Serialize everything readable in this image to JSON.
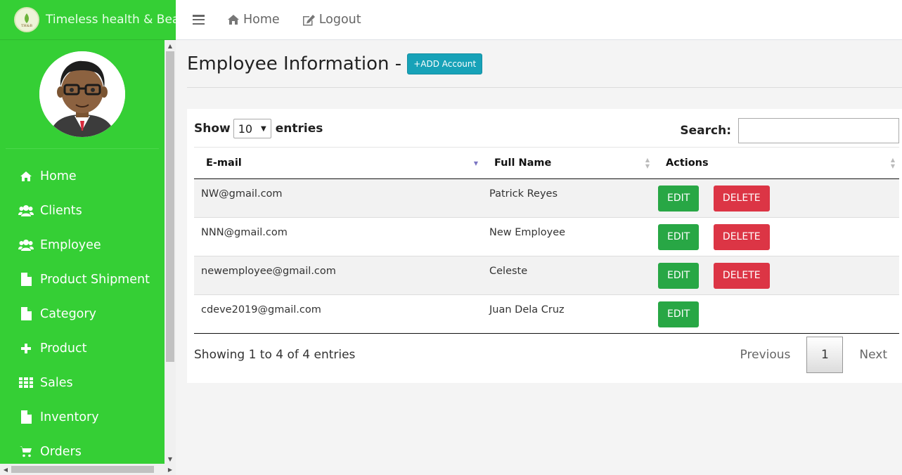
{
  "brand": {
    "title": "Timeless health & Beauty"
  },
  "topbar": {
    "home_label": "Home",
    "logout_label": "Logout"
  },
  "sidebar": {
    "items": [
      {
        "label": "Home",
        "icon": "home-icon"
      },
      {
        "label": "Clients",
        "icon": "users-icon"
      },
      {
        "label": "Employee",
        "icon": "users-icon"
      },
      {
        "label": "Product Shipment",
        "icon": "file-icon"
      },
      {
        "label": "Category",
        "icon": "file-icon"
      },
      {
        "label": "Product",
        "icon": "plus-icon"
      },
      {
        "label": "Sales",
        "icon": "grid-icon"
      },
      {
        "label": "Inventory",
        "icon": "file-icon"
      },
      {
        "label": "Orders",
        "icon": "cart-icon"
      }
    ]
  },
  "page": {
    "title": "Employee Information -",
    "add_button": "+ADD Account"
  },
  "datatable": {
    "show_label": "Show",
    "entries_label": "entries",
    "page_length": "10",
    "search_label": "Search:",
    "search_value": "",
    "columns": [
      "E-mail",
      "Full Name",
      "Actions"
    ],
    "rows": [
      {
        "email": "NW@gmail.com",
        "name": "Patrick Reyes",
        "actions": [
          "EDIT",
          "DELETE"
        ]
      },
      {
        "email": "NNN@gmail.com",
        "name": "New Employee",
        "actions": [
          "EDIT",
          "DELETE"
        ]
      },
      {
        "email": "newemployee@gmail.com",
        "name": "Celeste",
        "actions": [
          "EDIT",
          "DELETE"
        ]
      },
      {
        "email": "cdeve2019@gmail.com",
        "name": "Juan Dela Cruz",
        "actions": [
          "EDIT"
        ]
      }
    ],
    "info": "Showing 1 to 4 of 4 entries",
    "pagination": {
      "previous": "Previous",
      "current": "1",
      "next": "Next"
    }
  },
  "colors": {
    "sidebar": "#35cf35",
    "add_button": "#17a2b8",
    "edit": "#28a745",
    "delete": "#dc3545"
  }
}
